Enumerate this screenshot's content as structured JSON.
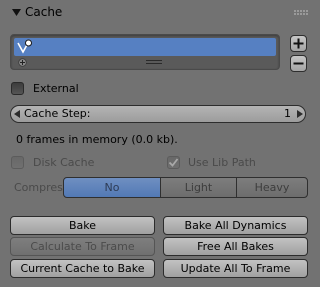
{
  "header": {
    "title": "Cache",
    "collapse_icon": "triangle-down-icon",
    "grip_icon": "drag-grip-icon"
  },
  "list": {
    "items": [
      {
        "icon": "point-cache-icon",
        "selected": true
      }
    ],
    "add_icon": "plus-icon",
    "remove_icon": "minus-icon"
  },
  "external": {
    "label": "External",
    "checked": false
  },
  "cache_step": {
    "label": "Cache Step:",
    "value": "1"
  },
  "memory_info": "0 frames in memory (0.0 kb).",
  "disk_cache": {
    "label": "Disk Cache",
    "checked": false,
    "enabled": false
  },
  "use_lib_path": {
    "label": "Use Lib Path",
    "checked": true,
    "enabled": false
  },
  "compression": {
    "label": "Compression:",
    "options": [
      "No",
      "Light",
      "Heavy"
    ],
    "selected": "No"
  },
  "buttons": {
    "bake": "Bake",
    "bake_all_dynamics": "Bake All Dynamics",
    "calculate_to_frame": "Calculate To Frame",
    "free_all_bakes": "Free All Bakes",
    "current_cache_to_bake": "Current Cache to Bake",
    "update_all_to_frame": "Update All To Frame"
  },
  "colors": {
    "panel_bg": "#727272",
    "selection": "#5680c2",
    "toggle_active": "#5279b5"
  }
}
